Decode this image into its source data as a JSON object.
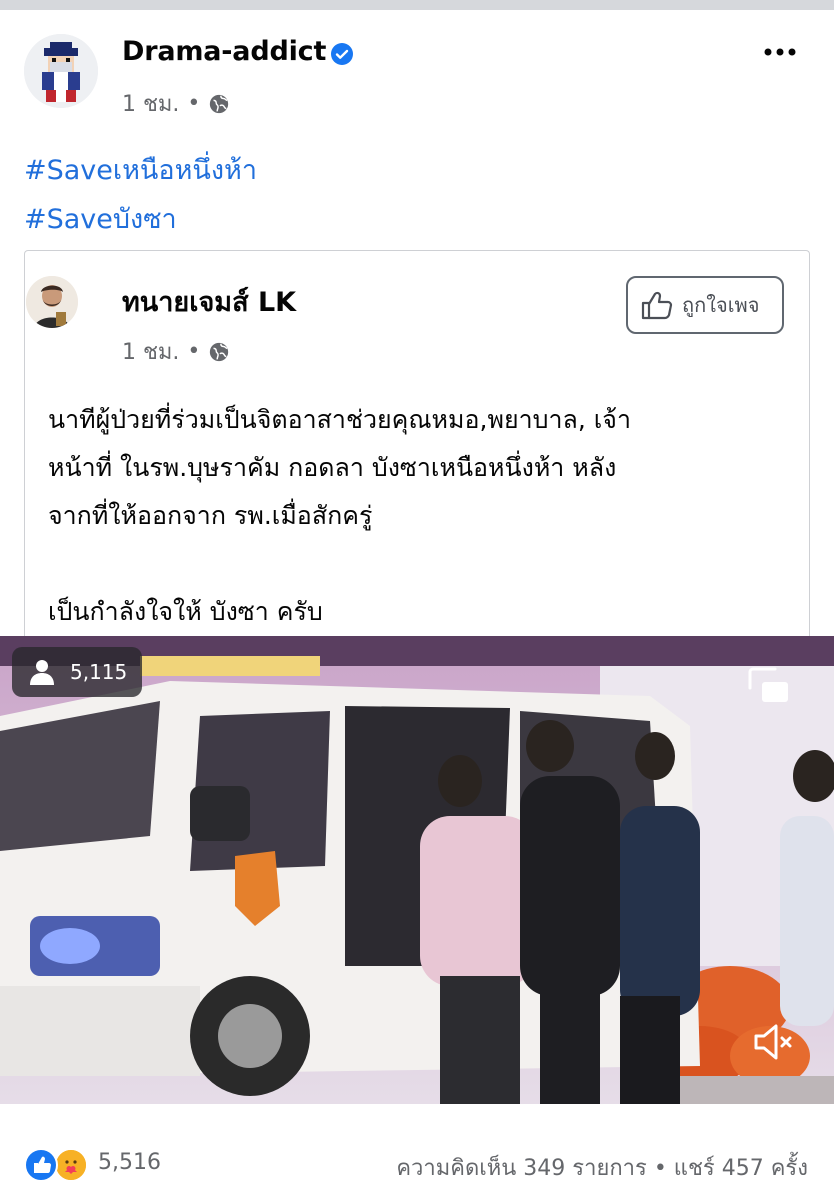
{
  "post": {
    "author": "Drama-addict",
    "time": "1 ชม.",
    "privacy_icon": "globe-icon",
    "hashtags": [
      "#Saveเหนือหนึ่งห้า",
      "#Saveบังซา"
    ]
  },
  "shared": {
    "author": "ทนายเจมส์ LK",
    "time": "1 ชม.",
    "like_page_label": "ถูกใจเพจ",
    "text_lines": [
      "นาทีผู้ป่วยที่ร่วมเป็นจิตอาสาช่วยคุณหมอ,พยาบาล, เจ้า",
      "หน้าที่ ในรพ.บุษราคัม กอดลา บังซาเหนือหนึ่งห้า หลัง",
      "จากที่ให้ออกจาก รพ.เมื่อสักครู่"
    ],
    "text_last": "เป็นกำลังใจให้ บังซา ครับ"
  },
  "video": {
    "viewers": "5,115"
  },
  "footer": {
    "reactions_count": "5,516",
    "stats": "ความคิดเห็น 349 รายการ • แชร์ 457 ครั้ง"
  },
  "colors": {
    "link": "#216fdb",
    "verified": "#1877f2",
    "meta": "#65676b"
  }
}
